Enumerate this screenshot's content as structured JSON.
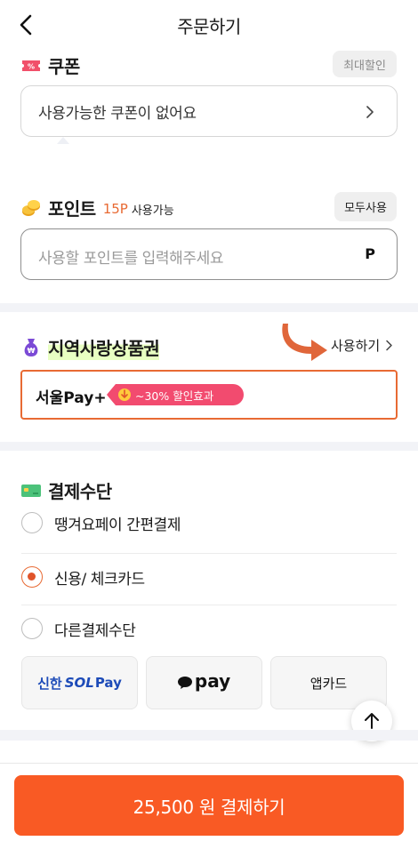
{
  "header": {
    "title": "주문하기"
  },
  "coupon": {
    "title": "쿠폰",
    "max_discount_label": "최대할인",
    "empty_text": "사용가능한 쿠폰이 없어요"
  },
  "point": {
    "title": "포인트",
    "available_amount": "15P",
    "available_suffix": "사용가능",
    "use_all_label": "모두사용",
    "input_placeholder": "사용할 포인트를 입력해주세요",
    "unit": "P"
  },
  "local_voucher": {
    "title": "지역사랑상품권",
    "use_label": "사용하기",
    "pay_name": "서울Pay+",
    "badge_text": "~30% 할인효과"
  },
  "payment": {
    "title": "결제수단",
    "options": [
      {
        "label": "땡겨요페이 간편결제",
        "selected": false
      },
      {
        "label": "신용/ 체크카드",
        "selected": true
      },
      {
        "label": "다른결제수단",
        "selected": false
      }
    ],
    "cards": {
      "shinhan_prefix": "신한",
      "shinhan_sol": "SOL",
      "shinhan_pay": "Pay",
      "kakaopay": "pay",
      "appcard": "앱카드"
    }
  },
  "submit": {
    "label": "25,500 원 결제하기"
  },
  "colors": {
    "accent": "#f95a24",
    "voucher_border": "#e86a33",
    "badge": "#f24b6f",
    "highlight": "#e8ffc2"
  }
}
